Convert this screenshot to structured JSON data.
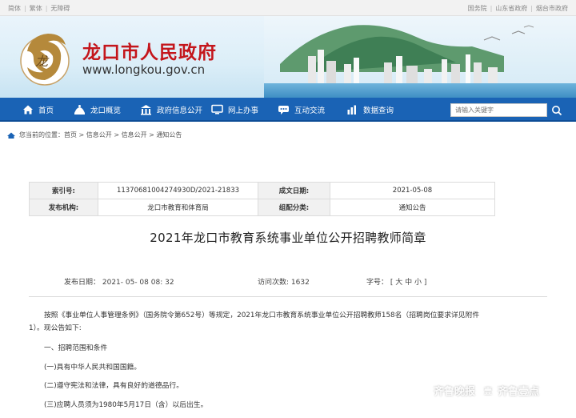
{
  "topbar": {
    "left_links": [
      "简体",
      "繁体",
      "无障碍"
    ],
    "right_links": [
      "国务院",
      "山东省政府",
      "烟台市政府"
    ]
  },
  "header": {
    "site_title": "龙口市人民政府",
    "site_url": "www.longkou.gov.cn",
    "title_color": "#c4161c"
  },
  "nav": {
    "bg_color": "#1a63b5",
    "items": [
      {
        "label": "首页",
        "icon": "home-icon"
      },
      {
        "label": "龙口概览",
        "icon": "overview-icon"
      },
      {
        "label": "政府信息公开",
        "icon": "government-icon"
      },
      {
        "label": "网上办事",
        "icon": "monitor-icon"
      },
      {
        "label": "互动交流",
        "icon": "chat-icon"
      },
      {
        "label": "数据查询",
        "icon": "chart-icon"
      }
    ],
    "search_placeholder": "请输入关键字"
  },
  "breadcrumb": {
    "text": "您当前的位置：首页 > 信息公开 > 信息公开 > 通知公告"
  },
  "info_table": {
    "index_label": "索引号:",
    "index_value": "11370681004274930D/2021-21833",
    "date_label": "成文日期:",
    "date_value": "2021-05-08",
    "publisher_label": "发布机构:",
    "publisher_value": "龙口市教育和体育局",
    "category_label": "组配分类:",
    "category_value": "通知公告"
  },
  "article": {
    "title": "2021年龙口市教育系统事业单位公开招聘教师简章",
    "publish_date": "发布日期： 2021- 05- 08 08: 32",
    "visits": "访问次数: 1632",
    "font_size_label": "字号：",
    "font_size_options": "[ 大 中 小 ]",
    "paragraphs": [
      "按照《事业单位人事管理条例》（国务院令第652号）等规定，2021年龙口市教育系统事业单位公开招聘教师158名（招聘岗位要求详见附件",
      "1）。现公告如下:",
      "一、招聘范围和条件",
      "(一)具有中华人民共和国国籍。",
      "(二)遵守宪法和法律，具有良好的道德品行。",
      "(三)应聘人员须为1980年5月17日（含）以后出生。"
    ]
  },
  "watermark": {
    "brand": "齐鲁晚报",
    "brand2": "齐鲁壹点"
  }
}
